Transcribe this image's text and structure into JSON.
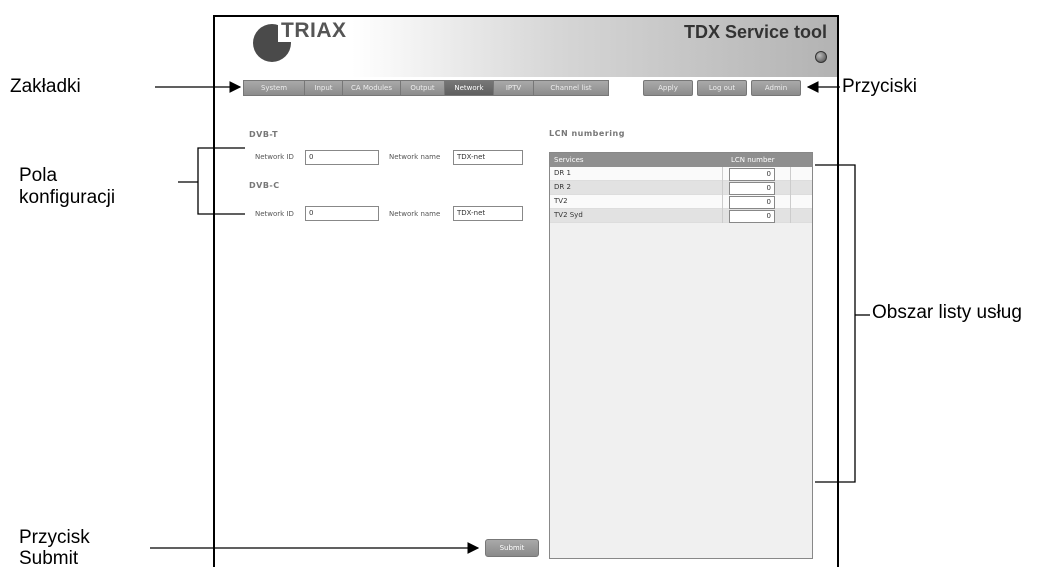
{
  "app": {
    "logo_text": "TRIAX",
    "title": "TDX Service tool"
  },
  "tabs": [
    "System",
    "Input",
    "CA Modules",
    "Output",
    "Network",
    "IPTV",
    "Channel list"
  ],
  "active_tab": "Network",
  "header_buttons": [
    "Apply",
    "Log out",
    "Admin"
  ],
  "dvbt": {
    "title": "DVB-T",
    "network_id_label": "Network ID",
    "network_id_value": "0",
    "network_name_label": "Network name",
    "network_name_value": "TDX-net"
  },
  "dvbc": {
    "title": "DVB-C",
    "network_id_label": "Network ID",
    "network_id_value": "0",
    "network_name_label": "Network name",
    "network_name_value": "TDX-net"
  },
  "lcn": {
    "title": "LCN numbering",
    "col_services": "Services",
    "col_lcn": "LCN number",
    "rows": [
      {
        "service": "DR 1",
        "lcn": "0"
      },
      {
        "service": "DR 2",
        "lcn": "0"
      },
      {
        "service": "TV2",
        "lcn": "0"
      },
      {
        "service": "TV2 Syd",
        "lcn": "0"
      }
    ]
  },
  "submit_label": "Submit",
  "annotations": {
    "tabs": "Zakładki",
    "buttons": "Przyciski",
    "config_fields_1": "Pola",
    "config_fields_2": "konfiguracji",
    "service_list_area": "Obszar listy usług",
    "submit_button_1": "Przycisk",
    "submit_button_2": "Submit"
  }
}
